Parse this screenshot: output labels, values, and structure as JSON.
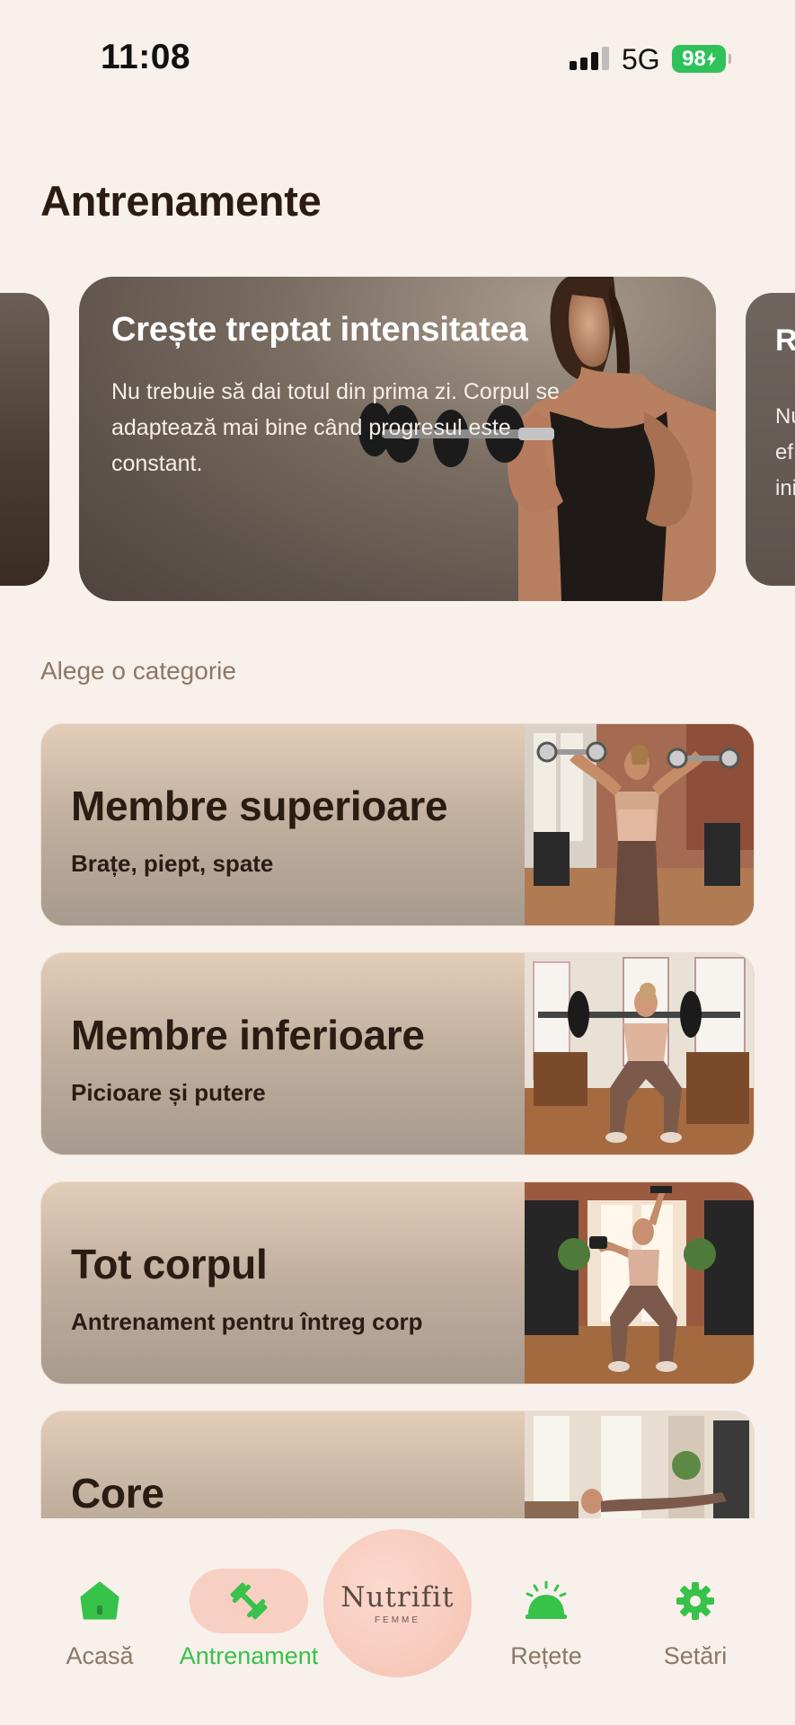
{
  "status_bar": {
    "time": "11:08",
    "network": "5G",
    "battery": "98"
  },
  "page_title": "Antrenamente",
  "tip_card": {
    "title": "Crește treptat intensitatea",
    "text": "Nu trebuie să dai totul din prima zi. Corpul se adaptează mai bine când progresul este constant."
  },
  "peek_right": {
    "title": "R",
    "text_lines": [
      "Nu",
      "ef",
      "ini"
    ]
  },
  "section_label": "Alege o categorie",
  "categories": [
    {
      "title": "Membre superioare",
      "subtitle": "Brațe, piept, spate"
    },
    {
      "title": "Membre inferioare",
      "subtitle": "Picioare și putere"
    },
    {
      "title": "Tot corpul",
      "subtitle": "Antrenament pentru întreg corp"
    },
    {
      "title": "Core",
      "subtitle": ""
    }
  ],
  "bottom_nav": {
    "items": [
      {
        "label": "Acasă",
        "icon": "home-icon",
        "active": false
      },
      {
        "label": "Antrenament",
        "icon": "dumbbell-icon",
        "active": true
      },
      {
        "label": "Rețete",
        "icon": "cloche-icon",
        "active": false
      },
      {
        "label": "Setări",
        "icon": "gear-icon",
        "active": false
      }
    ],
    "logo": {
      "name": "Nutrifit",
      "sub": "FEMME"
    }
  },
  "colors": {
    "background": "#f8f0ea",
    "accent_green": "#37c24a",
    "active_pill": "#f8cfc3",
    "muted_text": "#8c7766"
  }
}
